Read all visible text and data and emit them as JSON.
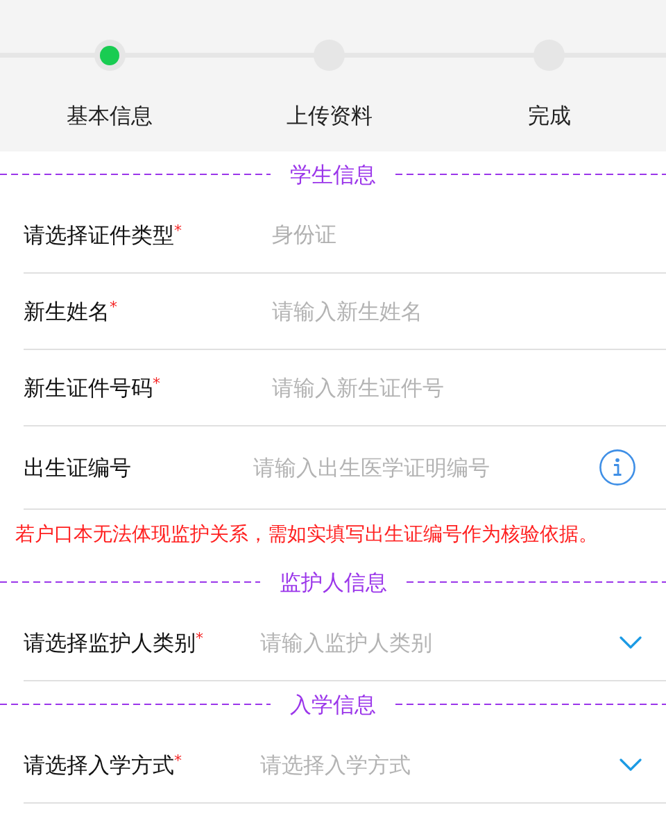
{
  "steps": [
    {
      "label": "基本信息",
      "selected": true
    },
    {
      "label": "上传资料",
      "selected": false
    },
    {
      "label": "完成",
      "selected": false
    }
  ],
  "sections": [
    {
      "title": "学生信息",
      "fields": [
        {
          "kind": "plain",
          "label": "请选择证件类型",
          "required_mark": "*",
          "value": "身份证"
        },
        {
          "kind": "plain",
          "label": "新生姓名",
          "required_mark": "*",
          "placeholder": "请输入新生姓名"
        },
        {
          "kind": "plain",
          "label": "新生证件号码",
          "required_mark": "*",
          "placeholder": "请输入新生证件号"
        },
        {
          "kind": "info",
          "label": "出生证编号",
          "placeholder": "请输入出生医学证明编号"
        }
      ],
      "note": "若户口本无法体现监护关系，需如实填写出生证编号作为核验依据。"
    },
    {
      "title": "监护人信息",
      "fields": [
        {
          "kind": "dropdown",
          "label": "请选择监护人类别",
          "required_mark": "*",
          "placeholder": "请输入监护人类别"
        }
      ]
    },
    {
      "title": "入学信息",
      "fields": [
        {
          "kind": "dropdown",
          "label": "请选择入学方式",
          "required_mark": "*",
          "placeholder": "请选择入学方式"
        }
      ]
    }
  ]
}
